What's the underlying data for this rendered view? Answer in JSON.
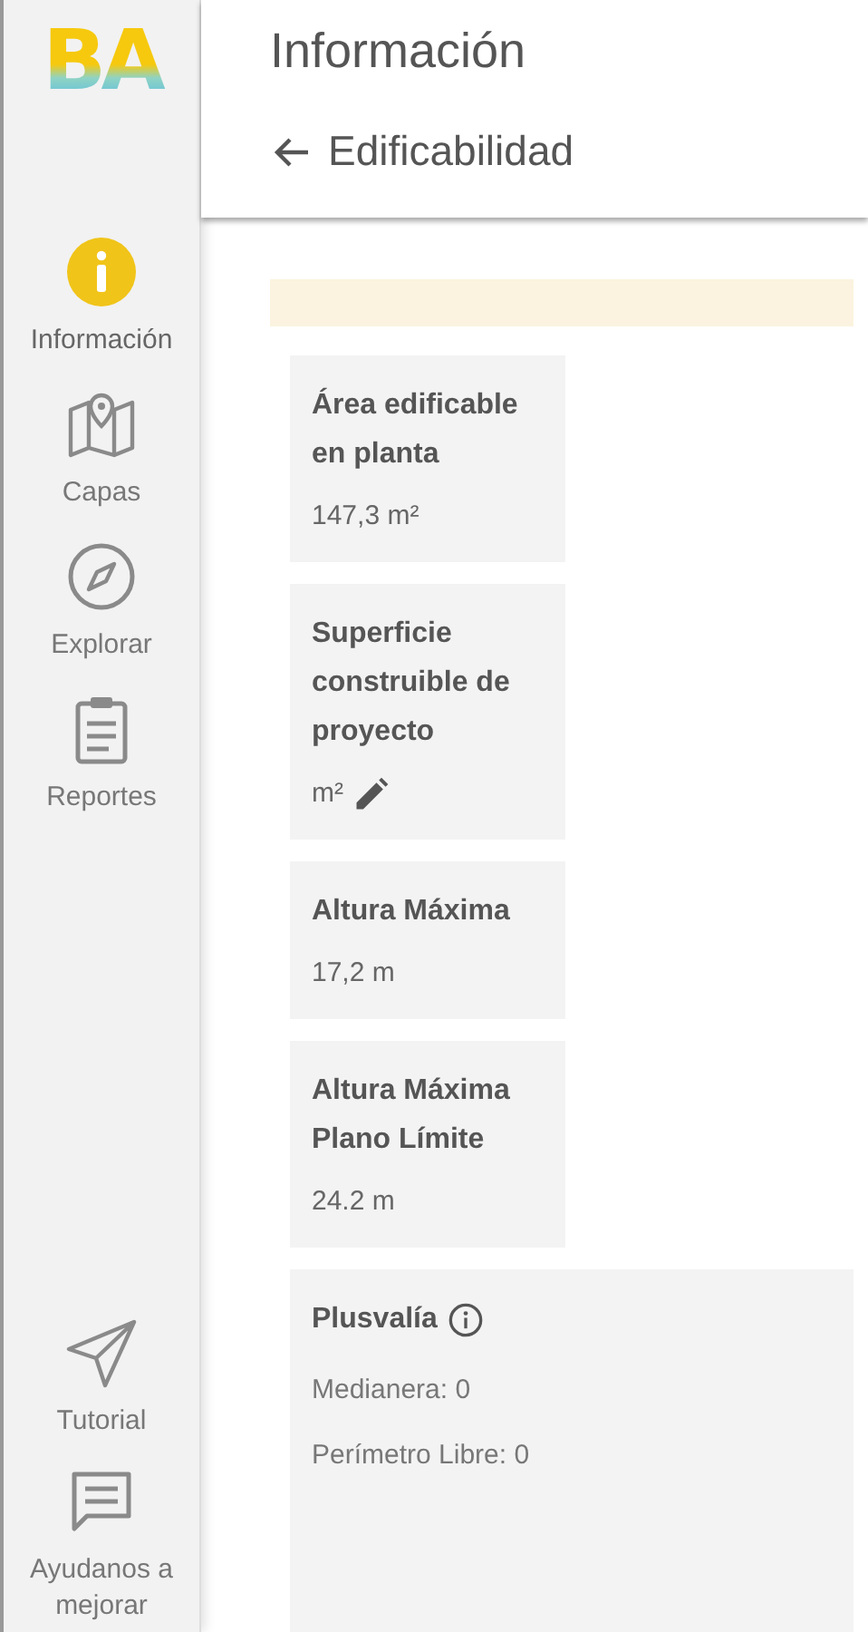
{
  "sidebar": {
    "logo": "BA",
    "items": [
      {
        "label": "Información",
        "selected": true
      },
      {
        "label": "Capas",
        "selected": false
      },
      {
        "label": "Explorar",
        "selected": false
      },
      {
        "label": "Reportes",
        "selected": false
      }
    ],
    "bottom_items": [
      {
        "label": "Tutorial"
      },
      {
        "label": "Ayudanos a mejorar"
      }
    ]
  },
  "header": {
    "title": "Información",
    "subtitle": "Edificabilidad"
  },
  "cards": [
    {
      "kind": "metric",
      "title": "Área edificable en planta",
      "value": "147,3 m²",
      "editable": false
    },
    {
      "kind": "metric",
      "title": "Superficie construible de proyecto",
      "value": "m²",
      "editable": true
    },
    {
      "kind": "metric",
      "title": "Altura Máxima",
      "value": "17,2 m",
      "editable": false
    },
    {
      "kind": "metric",
      "title": "Altura Máxima Plano Límite",
      "value": "24.2 m",
      "editable": false
    },
    {
      "kind": "list",
      "title": "Plusvalía",
      "info": true,
      "lines": [
        "Medianera: 0",
        "Perímetro Libre: 0"
      ]
    }
  ]
}
